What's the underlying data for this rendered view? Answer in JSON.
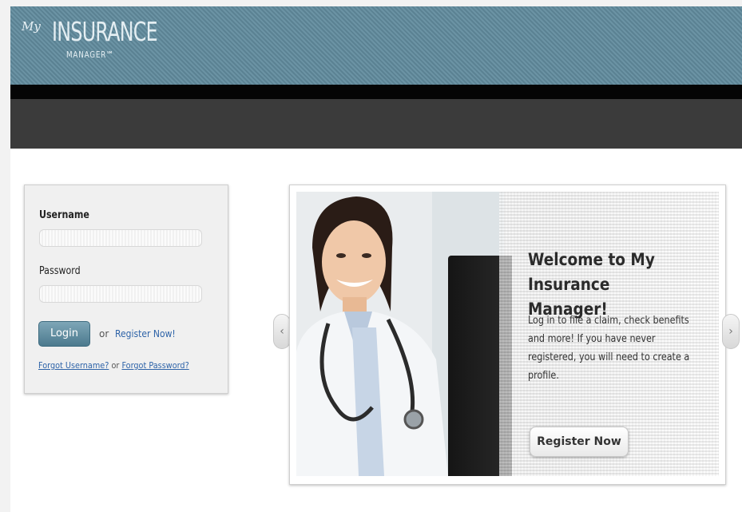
{
  "header": {
    "logo_signature": "My",
    "logo_title": "INSURANCE",
    "logo_subtitle": "MANAGER℠"
  },
  "login": {
    "username_label": "Username",
    "username_value": "",
    "password_label": "Password",
    "password_value": "",
    "login_button": "Login",
    "or_text": "or",
    "register_link": "Register Now!",
    "forgot_username": "Forgot Username?",
    "forgot_or": "or",
    "forgot_password": "Forgot Password?"
  },
  "slide": {
    "title": "Welcome to My Insurance Manager!",
    "description": "Log in to file a claim, check benefits and more! If you have never registered, you will need to create a profile.",
    "register_button": "Register Now"
  },
  "icons": {
    "prev": "chevron-left-icon",
    "next": "chevron-right-icon"
  },
  "colors": {
    "header": "#6b93a4",
    "navbar": "#3b3b3b",
    "login_button": "#5b8597",
    "link": "#2e63a8"
  }
}
